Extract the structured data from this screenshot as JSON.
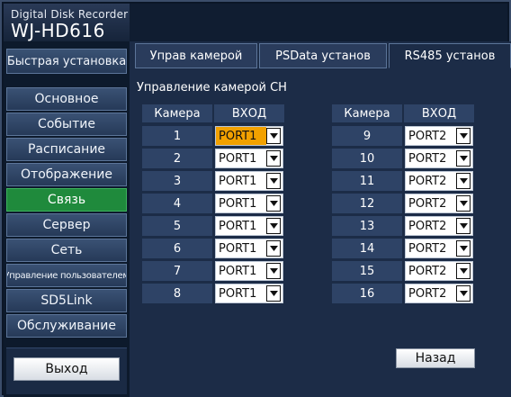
{
  "header": {
    "subtitle": "Digital Disk Recorder",
    "model": "WJ-HD616"
  },
  "sidebar": {
    "quick": "Быстрая установка",
    "items": [
      {
        "label": "Основное",
        "active": false
      },
      {
        "label": "Событие",
        "active": false
      },
      {
        "label": "Расписание",
        "active": false
      },
      {
        "label": "Отображение",
        "active": false
      },
      {
        "label": "Связь",
        "active": true
      },
      {
        "label": "Сервер",
        "active": false
      },
      {
        "label": "Сеть",
        "active": false
      },
      {
        "label": "Управление пользователем",
        "active": false
      },
      {
        "label": "SD5Link",
        "active": false
      },
      {
        "label": "Обслуживание",
        "active": false
      }
    ],
    "exit": "Выход"
  },
  "tabs": [
    {
      "label": "Управ камерой",
      "active": false
    },
    {
      "label": "PSData установ",
      "active": false
    },
    {
      "label": "RS485 установ",
      "active": true
    }
  ],
  "section_title": "Управление камерой CH",
  "columns": {
    "camera": "Камера",
    "input": "ВХОД"
  },
  "left_rows": [
    {
      "camera": "1",
      "port": "PORT1",
      "highlight": true
    },
    {
      "camera": "2",
      "port": "PORT1"
    },
    {
      "camera": "3",
      "port": "PORT1"
    },
    {
      "camera": "4",
      "port": "PORT1"
    },
    {
      "camera": "5",
      "port": "PORT1"
    },
    {
      "camera": "6",
      "port": "PORT1"
    },
    {
      "camera": "7",
      "port": "PORT1"
    },
    {
      "camera": "8",
      "port": "PORT1"
    }
  ],
  "right_rows": [
    {
      "camera": "9",
      "port": "PORT2"
    },
    {
      "camera": "10",
      "port": "PORT2"
    },
    {
      "camera": "11",
      "port": "PORT2"
    },
    {
      "camera": "12",
      "port": "PORT2"
    },
    {
      "camera": "13",
      "port": "PORT2"
    },
    {
      "camera": "14",
      "port": "PORT2"
    },
    {
      "camera": "15",
      "port": "PORT2"
    },
    {
      "camera": "16",
      "port": "PORT2"
    }
  ],
  "back": "Назад",
  "icons": {
    "dropdown": "triangle-down-icon"
  },
  "colors": {
    "active_nav": "#1f8a3c",
    "highlight": "#f2a100"
  }
}
